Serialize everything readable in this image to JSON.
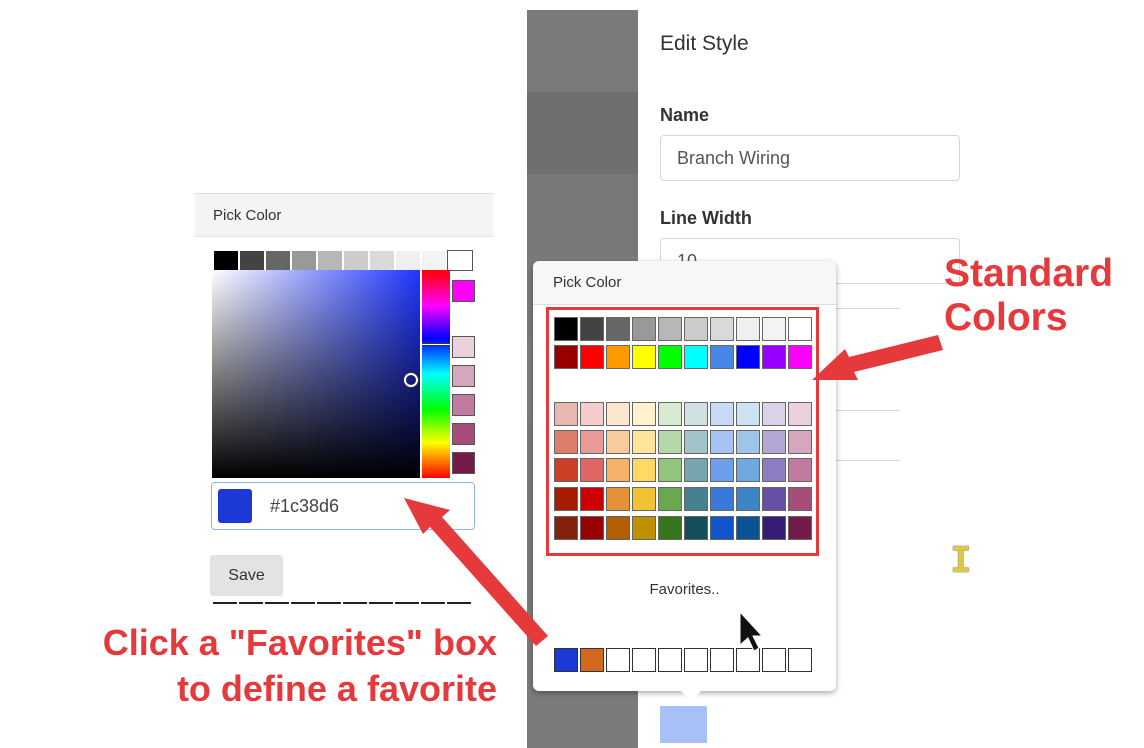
{
  "edit_panel": {
    "title": "Edit Style",
    "name_label": "Name",
    "name_value": "Branch Wiring",
    "line_width_label": "Line Width",
    "line_width_value": "10"
  },
  "left_picker": {
    "title": "Pick Color",
    "hex_value": "#1c38d6",
    "swatch_color": "#1c38d6",
    "save_label": "Save",
    "top_row_colors": [
      "#000000",
      "#434343",
      "#666666",
      "#999999",
      "#b7b7b7",
      "#cccccc",
      "#d9d9d9",
      "#efefef",
      "#f3f3f3",
      "#ffffff"
    ],
    "side_colors": [
      "#ff00ff",
      "#ead1dc",
      "#d5a6bd",
      "#c27ba0",
      "#a64d79",
      "#741b47"
    ]
  },
  "main_picker": {
    "title": "Pick Color",
    "favorites_label": "Favorites..",
    "standard_rows": [
      [
        "#000000",
        "#434343",
        "#666666",
        "#999999",
        "#b7b7b7",
        "#cccccc",
        "#d9d9d9",
        "#efefef",
        "#f3f3f3",
        "#ffffff"
      ],
      [
        "#980000",
        "#ff0000",
        "#ff9900",
        "#ffff00",
        "#00ff00",
        "#00ffff",
        "#4a86e8",
        "#0000ff",
        "#9900ff",
        "#ff00ff"
      ]
    ],
    "shade_rows": [
      [
        "#e6b8af",
        "#f4cccc",
        "#fce5cd",
        "#fff2cc",
        "#d9ead3",
        "#d0e0e3",
        "#c9daf8",
        "#cfe2f3",
        "#d9d2e9",
        "#ead1dc"
      ],
      [
        "#dd7e6b",
        "#ea9999",
        "#f9cb9c",
        "#ffe599",
        "#b6d7a8",
        "#a2c4c9",
        "#a4c2f4",
        "#9fc5e8",
        "#b4a7d6",
        "#d5a6bd"
      ],
      [
        "#cc4125",
        "#e06666",
        "#f6b26b",
        "#ffd966",
        "#93c47d",
        "#76a5af",
        "#6d9eeb",
        "#6fa8dc",
        "#8e7cc3",
        "#c27ba0"
      ],
      [
        "#a61c00",
        "#cc0000",
        "#e69138",
        "#f1c232",
        "#6aa84f",
        "#45818e",
        "#3c78d8",
        "#3d85c6",
        "#674ea7",
        "#a64d79"
      ],
      [
        "#85200c",
        "#990000",
        "#b45f06",
        "#bf9000",
        "#38761d",
        "#134f5c",
        "#1155cc",
        "#0b5394",
        "#351c75",
        "#741b47"
      ]
    ],
    "favorites": [
      "#1c38d6",
      "#d2691e",
      "#ffffff",
      "#ffffff",
      "#ffffff",
      "#ffffff",
      "#ffffff",
      "#ffffff",
      "#ffffff",
      "#ffffff"
    ]
  },
  "annotations": {
    "standard_colors_line1": "Standard",
    "standard_colors_line2": "Colors",
    "favorites_line1": "Click a \"Favorites\" box",
    "favorites_line2": "to define a favorite",
    "color": "#e5393b"
  },
  "overlay_bands": [
    "#7a7a7a",
    "#6f6f6f",
    "#787878",
    "#7b7b7b",
    "#7e7e7e",
    "#7b7b7b",
    "#7b7b7b",
    "#7b7b7b",
    "#7b7b7b"
  ]
}
